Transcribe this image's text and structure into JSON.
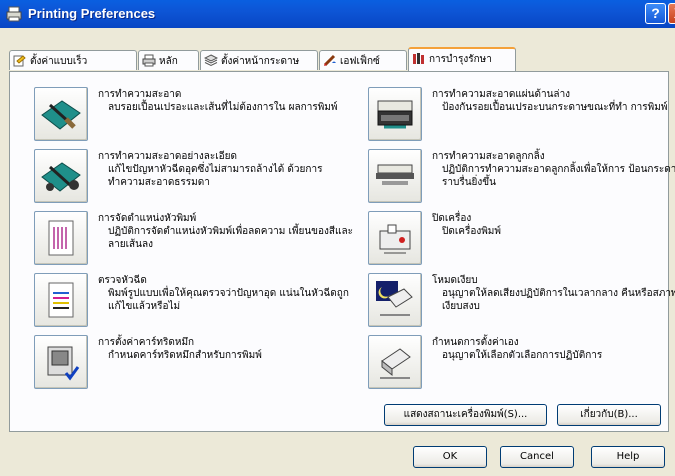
{
  "window": {
    "title": "Printing Preferences",
    "help_glyph": "?",
    "close_glyph": "X"
  },
  "tabs": [
    {
      "label": "ตั้งค่าแบบเร็ว",
      "icon": "quick-settings-icon"
    },
    {
      "label": "หลัก",
      "icon": "main-icon"
    },
    {
      "label": "ตั้งค่าหน้ากระดาษ",
      "icon": "page-setup-icon"
    },
    {
      "label": "เอฟเฟ็กซ์",
      "icon": "effects-icon"
    },
    {
      "label": "การบำรุงรักษา",
      "icon": "maintenance-icon",
      "active": true
    }
  ],
  "items": [
    {
      "title": "การทำความสะอาด",
      "desc": "ลบรอยเปื้อนเปรอะและเส้นที่ไม่ต้องการใน ผลการพิมพ์",
      "icon": "cleaning-icon"
    },
    {
      "title": "การทำความสะอาดแผ่นด้านล่าง",
      "desc": "ป้องกันรอยเปื้อนเปรอะบนกระดาษขณะที่ทำ การพิมพ์",
      "icon": "bottom-plate-cleaning-icon"
    },
    {
      "title": "การทำความสะอาดอย่างละเอียด",
      "desc": "แก้ไขปัญหาหัวฉีดอุดซึ่งไม่สามารถล้างได้ ด้วยการทำความสะอาดธรรมดา",
      "icon": "deep-cleaning-icon"
    },
    {
      "title": "การทำความสะอาดลูกกลิ้ง",
      "desc": "ปฏิบัติการทำความสะอาดลูกกลิ้งเพื่อให้การ ป้อนกระดาษราบรื่นยิ่งขึ้น",
      "icon": "roller-cleaning-icon"
    },
    {
      "title": "การจัดตำแหน่งหัวพิมพ์",
      "desc": "ปฏิบัติการจัดตำแหน่งหัวพิมพ์เพื่อลดความ เพี้ยนของสีและลายเส้นลง",
      "icon": "head-alignment-icon"
    },
    {
      "title": "ปิดเครื่อง",
      "desc": "ปิดเครื่องพิมพ์",
      "icon": "power-off-icon"
    },
    {
      "title": "ตรวจหัวฉีด",
      "desc": "พิมพ์รูปแบบเพื่อให้คุณตรวจว่าปัญหาอุด แน่นในหัวฉีดถูกแก้ไขแล้วหรือไม่",
      "icon": "nozzle-check-icon"
    },
    {
      "title": "โหมดเงียบ",
      "desc": "อนุญาตให้ลดเสียงปฏิบัติการในเวลากลาง คืนหรือสภาพเงียบสงบ",
      "icon": "quiet-mode-icon"
    },
    {
      "title": "การตั้งค่าคาร์ทริดหมึก",
      "desc": "กำหนดคาร์ทริดหมึกสำหรับการพิมพ์",
      "icon": "ink-cartridge-icon"
    },
    {
      "title": "กำหนดการตั้งค่าเอง",
      "desc": "อนุญาตให้เลือกตัวเลือกการปฏิบัติการ",
      "icon": "custom-settings-icon"
    }
  ],
  "buttons": {
    "printer_status": "แสดงสถานะเครื่องพิมพ์(S)...",
    "about": "เกี่ยวกับ(B)...",
    "ok": "OK",
    "cancel": "Cancel",
    "help": "Help"
  },
  "colors": {
    "titlebar": "#0a5fe0",
    "tab_highlight": "#f4a13a",
    "teal": "#1f8f8a"
  }
}
